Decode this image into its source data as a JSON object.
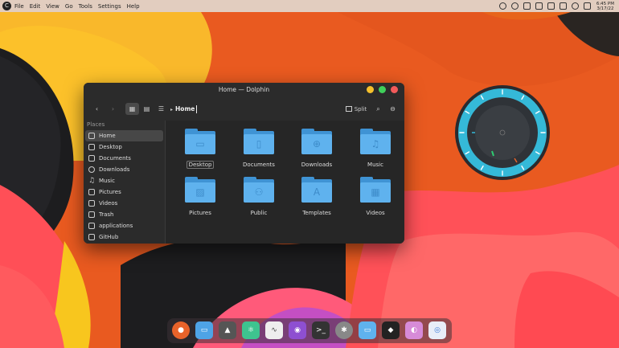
{
  "topbar": {
    "logo": "C",
    "menu": [
      "File",
      "Edit",
      "View",
      "Go",
      "Tools",
      "Settings",
      "Help"
    ],
    "clock_time": "6:45 PM",
    "clock_date": "3/17/22"
  },
  "window": {
    "title": "Home — Dolphin",
    "breadcrumb": "Home",
    "split_label": "Split"
  },
  "sidebar": {
    "header": "Places",
    "items": [
      {
        "label": "Home",
        "icon": "home-icon"
      },
      {
        "label": "Desktop",
        "icon": "desktop-icon"
      },
      {
        "label": "Documents",
        "icon": "documents-icon"
      },
      {
        "label": "Downloads",
        "icon": "downloads-icon"
      },
      {
        "label": "Music",
        "icon": "music-icon"
      },
      {
        "label": "Pictures",
        "icon": "pictures-icon"
      },
      {
        "label": "Videos",
        "icon": "videos-icon"
      },
      {
        "label": "Trash",
        "icon": "trash-icon"
      },
      {
        "label": "applications",
        "icon": "folder-icon"
      },
      {
        "label": "GitHub",
        "icon": "folder-icon"
      }
    ]
  },
  "folders": [
    {
      "label": "Desktop",
      "glyph": "▭"
    },
    {
      "label": "Documents",
      "glyph": "▯"
    },
    {
      "label": "Downloads",
      "glyph": "⊕"
    },
    {
      "label": "Music",
      "glyph": "♫"
    },
    {
      "label": "Pictures",
      "glyph": "▨"
    },
    {
      "label": "Public",
      "glyph": "⚇"
    },
    {
      "label": "Templates",
      "glyph": "A"
    },
    {
      "label": "Videos",
      "glyph": "▦"
    }
  ],
  "dock": [
    {
      "name": "firefox",
      "color": "#e8632a"
    },
    {
      "name": "files",
      "color": "#4ea3e6"
    },
    {
      "name": "inkscape",
      "color": "#555555"
    },
    {
      "name": "atom",
      "color": "#3ec48f"
    },
    {
      "name": "system-monitor",
      "color": "#eeeeee"
    },
    {
      "name": "github",
      "color": "#8e4fd1"
    },
    {
      "name": "terminal",
      "color": "#333333"
    },
    {
      "name": "settings",
      "color": "#888888"
    },
    {
      "name": "folder",
      "color": "#5fb2ee"
    },
    {
      "name": "figma",
      "color": "#222222"
    },
    {
      "name": "color-picker",
      "color": "#d78bd8"
    },
    {
      "name": "chromium",
      "color": "#e8eef8"
    }
  ]
}
